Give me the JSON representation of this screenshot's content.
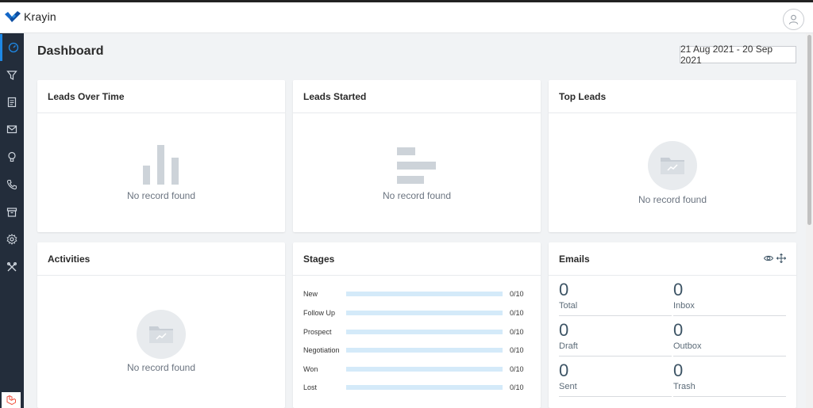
{
  "app": {
    "name": "Krayin"
  },
  "colors": {
    "accent": "#1e88e5",
    "sidebar": "#232d3b",
    "brand": "#1467c7"
  },
  "sidebar": {
    "items": [
      {
        "icon": "dashboard-icon",
        "active": true
      },
      {
        "icon": "filter-icon"
      },
      {
        "icon": "document-icon"
      },
      {
        "icon": "mail-icon"
      },
      {
        "icon": "lightbulb-icon"
      },
      {
        "icon": "phone-icon"
      },
      {
        "icon": "archive-icon"
      },
      {
        "icon": "settings-icon"
      },
      {
        "icon": "tools-icon"
      }
    ]
  },
  "page": {
    "title": "Dashboard",
    "date_range": "21 Aug 2021 - 20 Sep 2021"
  },
  "cards": {
    "leads_over_time": {
      "title": "Leads Over Time",
      "empty": "No record found"
    },
    "leads_started": {
      "title": "Leads Started",
      "empty": "No record found"
    },
    "top_leads": {
      "title": "Top Leads",
      "empty": "No record found"
    },
    "activities": {
      "title": "Activities",
      "empty": "No record found"
    },
    "stages": {
      "title": "Stages",
      "rows": [
        {
          "label": "New",
          "value": "0/10",
          "progress": 0
        },
        {
          "label": "Follow Up",
          "value": "0/10",
          "progress": 0
        },
        {
          "label": "Prospect",
          "value": "0/10",
          "progress": 0
        },
        {
          "label": "Negotiation",
          "value": "0/10",
          "progress": 0
        },
        {
          "label": "Won",
          "value": "0/10",
          "progress": 0
        },
        {
          "label": "Lost",
          "value": "0/10",
          "progress": 0
        }
      ]
    },
    "emails": {
      "title": "Emails",
      "items": [
        {
          "count": "0",
          "label": "Total"
        },
        {
          "count": "0",
          "label": "Inbox"
        },
        {
          "count": "0",
          "label": "Draft"
        },
        {
          "count": "0",
          "label": "Outbox"
        },
        {
          "count": "0",
          "label": "Sent"
        },
        {
          "count": "0",
          "label": "Trash"
        }
      ]
    }
  }
}
